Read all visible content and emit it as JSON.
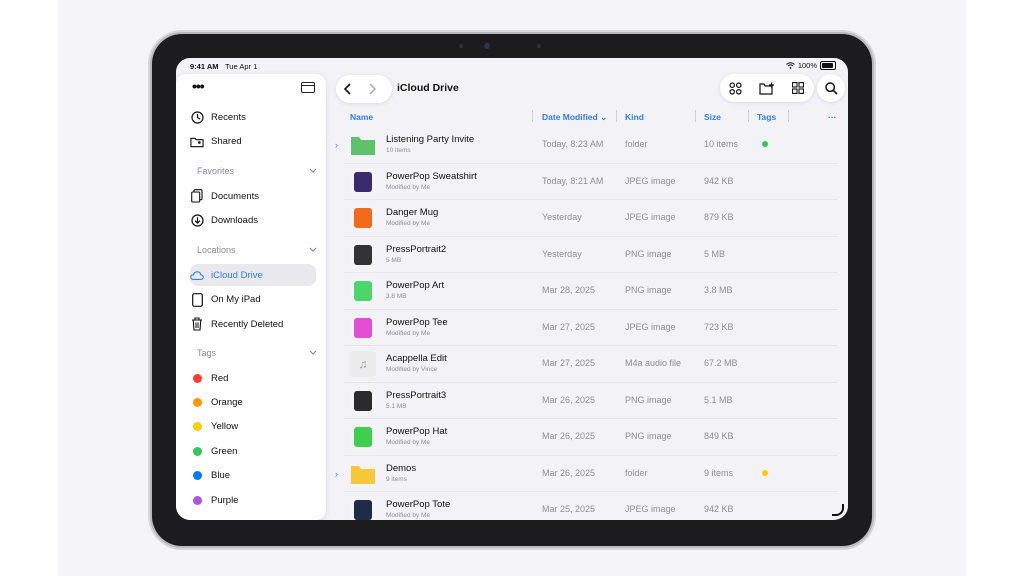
{
  "status": {
    "time": "9:41 AM",
    "date": "Tue Apr 1",
    "battery": "100%"
  },
  "sidebar": {
    "more_icon": "ellipsis-icon",
    "items_top": [
      {
        "label": "Recents",
        "icon": "clock-icon"
      },
      {
        "label": "Shared",
        "icon": "shared-folder-icon"
      }
    ],
    "favorites": {
      "title": "Favorites",
      "items": [
        {
          "label": "Documents",
          "icon": "documents-icon"
        },
        {
          "label": "Downloads",
          "icon": "download-icon"
        }
      ]
    },
    "locations": {
      "title": "Locations",
      "items": [
        {
          "label": "iCloud Drive",
          "icon": "cloud-icon",
          "selected": true
        },
        {
          "label": "On My iPad",
          "icon": "ipad-icon"
        },
        {
          "label": "Recently Deleted",
          "icon": "trash-icon"
        }
      ]
    },
    "tags": {
      "title": "Tags",
      "items": [
        {
          "label": "Red",
          "color": "#ff3b30"
        },
        {
          "label": "Orange",
          "color": "#ff9500"
        },
        {
          "label": "Yellow",
          "color": "#ffcc00"
        },
        {
          "label": "Green",
          "color": "#34c759"
        },
        {
          "label": "Blue",
          "color": "#007aff"
        },
        {
          "label": "Purple",
          "color": "#af52de"
        }
      ]
    }
  },
  "header": {
    "title": "iCloud Drive"
  },
  "columns": {
    "name": "Name",
    "date": "Date Modified",
    "kind": "Kind",
    "size": "Size",
    "tags": "Tags",
    "more": "···"
  },
  "files": [
    {
      "name": "Listening Party Invite",
      "sub": "10 items",
      "date": "Today, 8:23 AM",
      "kind": "folder",
      "size": "10 items",
      "tag": "#34c759",
      "folder": true,
      "thumb": "#5fc26b"
    },
    {
      "name": "PowerPop Sweatshirt",
      "sub": "Modified by Me",
      "date": "Today, 8:21 AM",
      "kind": "JPEG image",
      "size": "942 KB",
      "thumb": "#3a2a6e"
    },
    {
      "name": "Danger Mug",
      "sub": "Modified by Me",
      "date": "Yesterday",
      "kind": "JPEG image",
      "size": "879 KB",
      "thumb": "#f26a1b"
    },
    {
      "name": "PressPortrait2",
      "sub": "5 MB",
      "date": "Yesterday",
      "kind": "PNG image",
      "size": "5 MB",
      "thumb": "#333333"
    },
    {
      "name": "PowerPop Art",
      "sub": "3.8 MB",
      "date": "Mar 28, 2025",
      "kind": "PNG image",
      "size": "3.8 MB",
      "thumb": "#4bd66b"
    },
    {
      "name": "PowerPop Tee",
      "sub": "Modified by Me",
      "date": "Mar 27, 2025",
      "kind": "JPEG image",
      "size": "723 KB",
      "thumb": "#e24fd0"
    },
    {
      "name": "Acappella Edit",
      "sub": "Modified by Vince",
      "date": "Mar 27, 2025",
      "kind": "M4a audio file",
      "size": "67.2 MB",
      "thumb": "#ececec",
      "audio": true
    },
    {
      "name": "PressPortrait3",
      "sub": "5.1 MB",
      "date": "Mar 26, 2025",
      "kind": "PNG image",
      "size": "5.1 MB",
      "thumb": "#2b2b2b"
    },
    {
      "name": "PowerPop Hat",
      "sub": "Modified by Me",
      "date": "Mar 26, 2025",
      "kind": "PNG image",
      "size": "849 KB",
      "thumb": "#3fcf4f"
    },
    {
      "name": "Demos",
      "sub": "9 items",
      "date": "Mar 26, 2025",
      "kind": "folder",
      "size": "9 items",
      "tag": "#ffcc00",
      "folder": true,
      "thumb": "#f5c83a"
    },
    {
      "name": "PowerPop Tote",
      "sub": "Modified by Me",
      "date": "Mar 25, 2025",
      "kind": "JPEG image",
      "size": "942 KB",
      "thumb": "#1f2b4a"
    }
  ]
}
